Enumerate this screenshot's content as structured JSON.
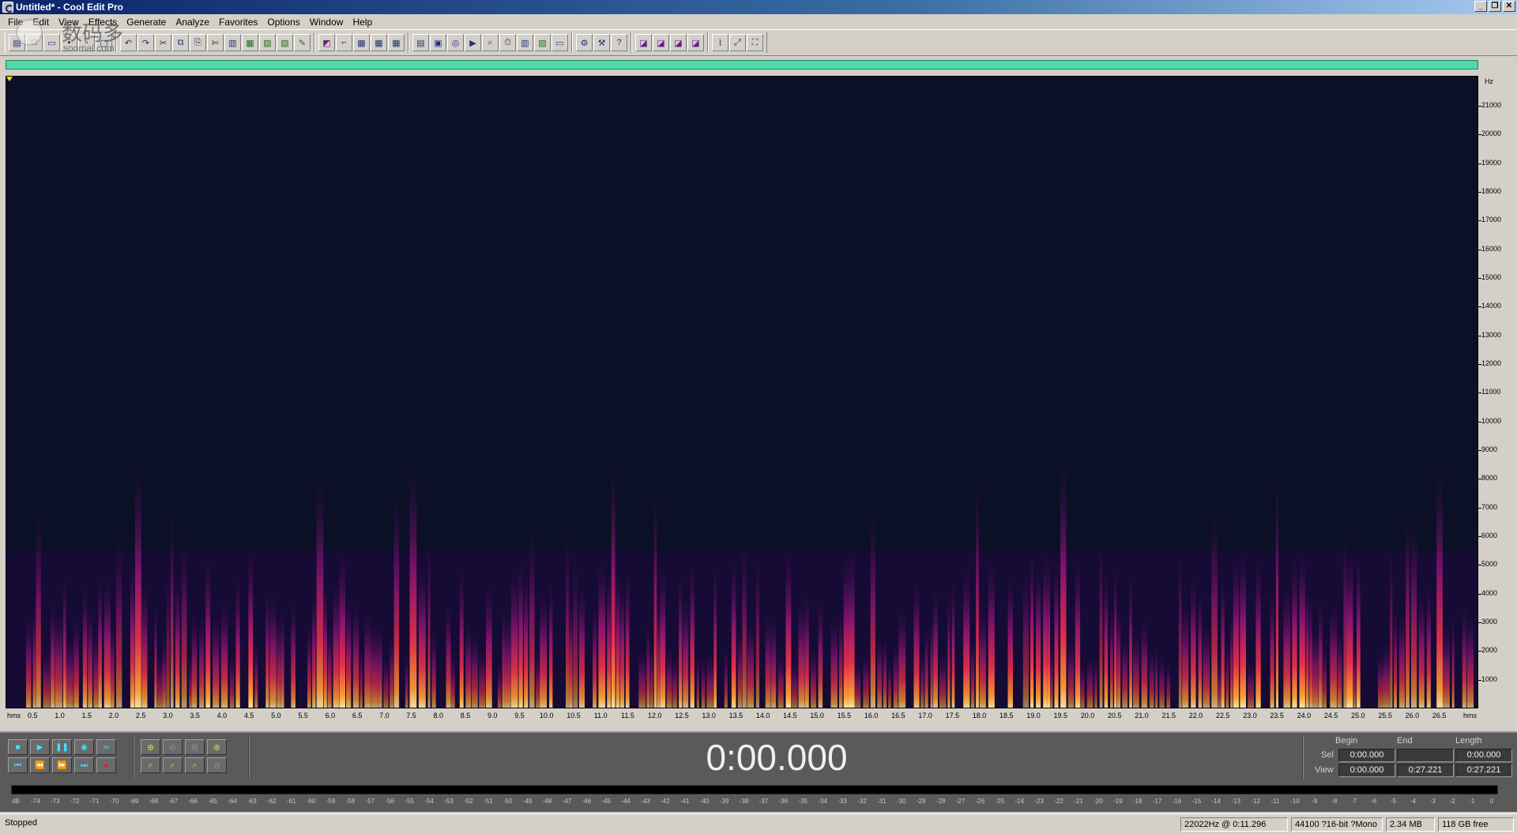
{
  "window": {
    "title": "Untitled* - Cool Edit Pro",
    "controls": [
      "_",
      "❐",
      "✕"
    ]
  },
  "menu": [
    {
      "label": "File"
    },
    {
      "label": "Edit"
    },
    {
      "label": "View"
    },
    {
      "label": "Effects"
    },
    {
      "label": "Generate"
    },
    {
      "label": "Analyze"
    },
    {
      "label": "Favorites"
    },
    {
      "label": "Options"
    },
    {
      "label": "Window"
    },
    {
      "label": "Help"
    }
  ],
  "watermark": {
    "main": "数码多",
    "sub": "soomal.com"
  },
  "spectrogram": {
    "frequency_unit": "Hz",
    "frequency_ticks": [
      21000,
      20000,
      19000,
      18000,
      17000,
      16000,
      15000,
      14000,
      13000,
      12000,
      11000,
      10000,
      9000,
      8000,
      7000,
      6000,
      5000,
      4000,
      3000,
      2000,
      1000
    ],
    "max_frequency": 22050,
    "time_unit": "hms",
    "time_ticks": [
      "0.5",
      "1.0",
      "1.5",
      "2.0",
      "2.5",
      "3.0",
      "3.5",
      "4.0",
      "4.5",
      "5.0",
      "5.5",
      "6.0",
      "6.5",
      "7.0",
      "7.5",
      "8.0",
      "8.5",
      "9.0",
      "9.5",
      "10.0",
      "10.5",
      "11.0",
      "11.5",
      "12.0",
      "12.5",
      "13.0",
      "13.5",
      "14.0",
      "14.5",
      "15.0",
      "15.5",
      "16.0",
      "16.5",
      "17.0",
      "17.5",
      "18.0",
      "18.5",
      "19.0",
      "19.5",
      "20.0",
      "20.5",
      "21.0",
      "21.5",
      "22.0",
      "22.5",
      "23.0",
      "23.5",
      "24.0",
      "24.5",
      "25.0",
      "25.5",
      "26.0",
      "26.5"
    ],
    "duration_seconds": 27.221,
    "colors": {
      "background": "#0a0f24",
      "low": "#3a0a5a",
      "mid": "#c81e5a",
      "high": "#ff8c28",
      "peak": "#fff0a0"
    }
  },
  "time_display": "0:00.000",
  "selection": {
    "headers": {
      "begin": "Begin",
      "end": "End",
      "length": "Length"
    },
    "sel": {
      "label": "Sel",
      "begin": "0:00.000",
      "end": "",
      "length": "0:00.000"
    },
    "view": {
      "label": "View",
      "begin": "0:00.000",
      "end": "0:27.221",
      "length": "0:27.221"
    }
  },
  "meter_scale": [
    "dB",
    "-74",
    "-73",
    "-72",
    "-71",
    "-70",
    "-69",
    "-68",
    "-67",
    "-66",
    "-65",
    "-64",
    "-63",
    "-62",
    "-61",
    "-60",
    "-59",
    "-58",
    "-57",
    "-56",
    "-55",
    "-54",
    "-53",
    "-52",
    "-51",
    "-50",
    "-49",
    "-48",
    "-47",
    "-46",
    "-45",
    "-44",
    "-43",
    "-42",
    "-41",
    "-40",
    "-39",
    "-38",
    "-37",
    "-36",
    "-35",
    "-34",
    "-33",
    "-32",
    "-31",
    "-30",
    "-29",
    "-28",
    "-27",
    "-26",
    "-25",
    "-24",
    "-23",
    "-22",
    "-21",
    "-20",
    "-19",
    "-18",
    "-17",
    "-16",
    "-15",
    "-14",
    "-13",
    "-12",
    "-11",
    "-10",
    "-9",
    "-8",
    "-7",
    "-6",
    "-5",
    "-4",
    "-3",
    "-2",
    "-1",
    "0"
  ],
  "status": {
    "state": "Stopped",
    "cursor": "22022Hz @   0:11.296",
    "format": "44100 ?16-bit ?Mono",
    "size": "2.34 MB",
    "free": "118 GB free"
  }
}
